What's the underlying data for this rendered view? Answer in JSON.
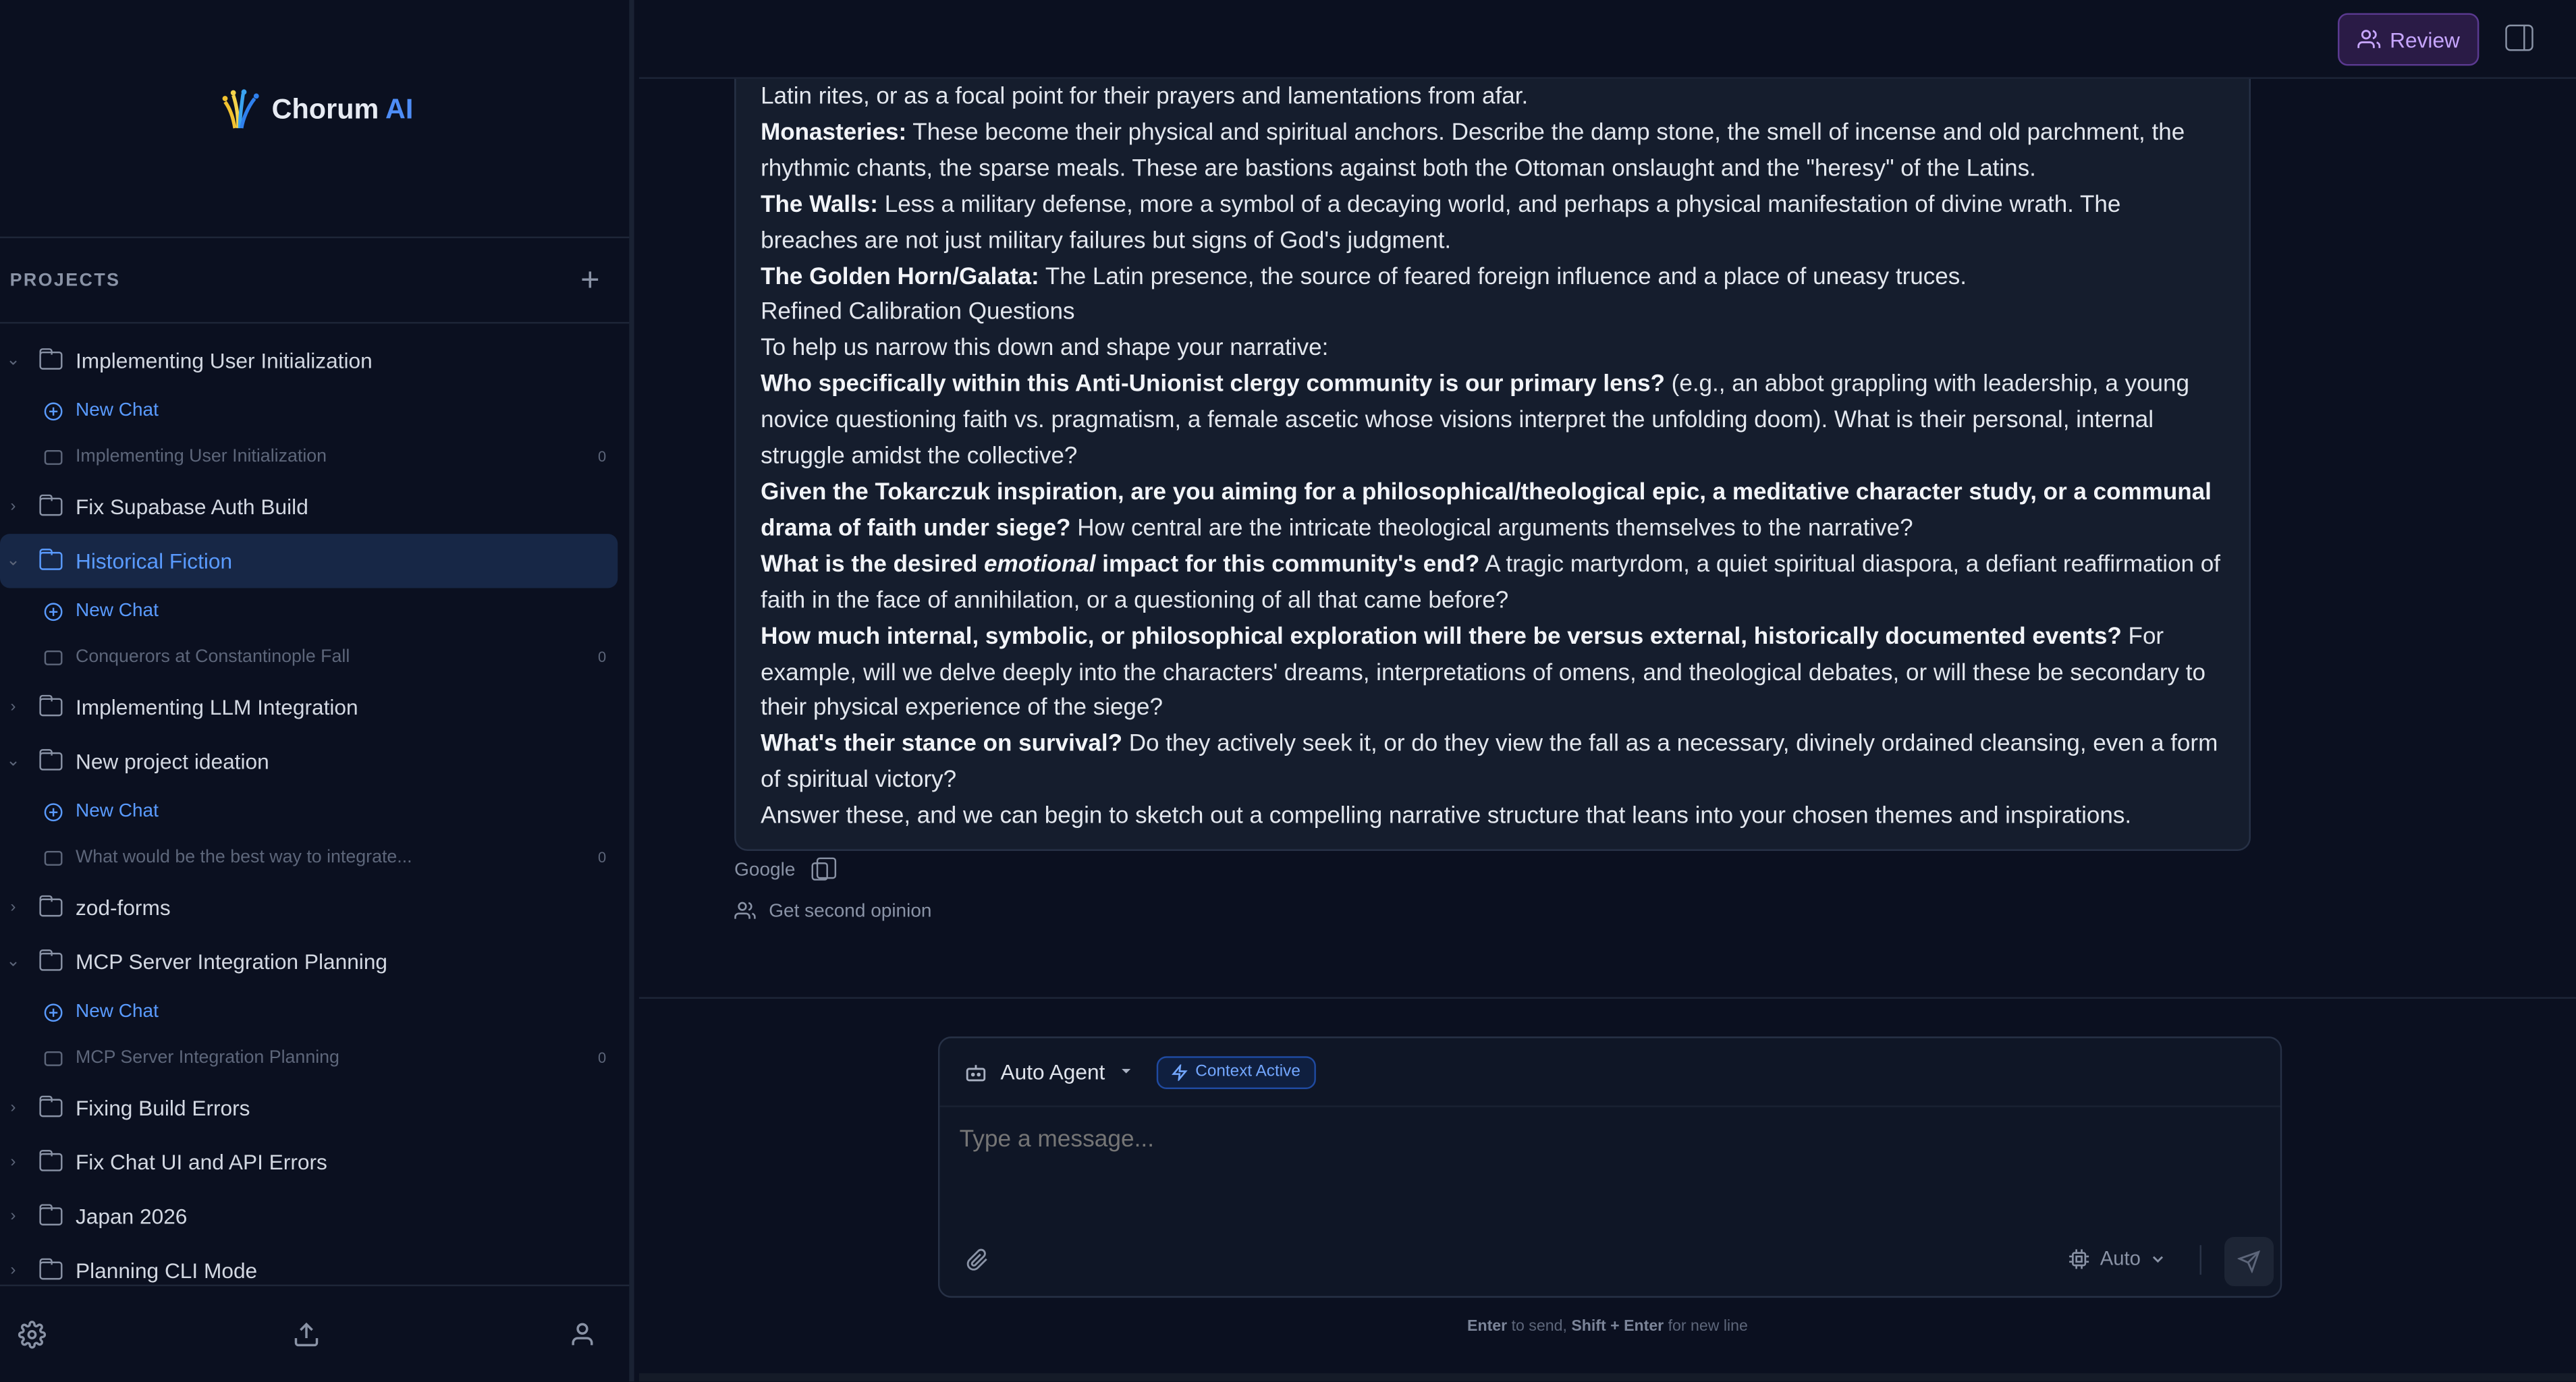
{
  "brand": {
    "name": "Chorum",
    "suffix": "AI"
  },
  "sidebar": {
    "section_label": "PROJECTS",
    "projects": [
      {
        "name": "Implementing User Initialization",
        "expanded": true,
        "new_chat": "New Chat",
        "chats": [
          {
            "title": "Implementing User Initialization",
            "count": "0"
          }
        ]
      },
      {
        "name": "Fix Supabase Auth Build",
        "expanded": false
      },
      {
        "name": "Historical Fiction",
        "expanded": true,
        "active": true,
        "new_chat": "New Chat",
        "chats": [
          {
            "title": "Conquerors at Constantinople Fall",
            "count": "0"
          }
        ]
      },
      {
        "name": "Implementing LLM Integration",
        "expanded": false
      },
      {
        "name": "New project ideation",
        "expanded": true,
        "new_chat": "New Chat",
        "chats": [
          {
            "title": "What would be the best way to integrate...",
            "count": "0"
          }
        ]
      },
      {
        "name": "zod-forms",
        "expanded": false
      },
      {
        "name": "MCP Server Integration Planning",
        "expanded": true,
        "new_chat": "New Chat",
        "chats": [
          {
            "title": "MCP Server Integration Planning",
            "count": "0"
          }
        ]
      },
      {
        "name": "Fixing Build Errors",
        "expanded": false
      },
      {
        "name": "Fix Chat UI and API Errors",
        "expanded": false
      },
      {
        "name": "Japan 2026",
        "expanded": false
      },
      {
        "name": "Planning CLI Mode",
        "expanded": false
      }
    ]
  },
  "topbar": {
    "review_label": "Review"
  },
  "message": {
    "line_0": "Latin rites, or as a focal point for their prayers and lamentations from afar.",
    "monasteries_b": "Monasteries:",
    "monasteries_t": " These become their physical and spiritual anchors. Describe the damp stone, the smell of incense and old parchment, the rhythmic chants, the sparse meals. These are bastions against both the Ottoman onslaught and the \"heresy\" of the Latins.",
    "walls_b": "The Walls:",
    "walls_t": " Less a military defense, more a symbol of a decaying world, and perhaps a physical manifestation of divine wrath. The breaches are not just military failures but signs of God's judgment.",
    "horn_b": "The Golden Horn/Galata:",
    "horn_t": " The Latin presence, the source of feared foreign influence and a place of uneasy truces.",
    "heading": "Refined Calibration Questions",
    "intro": "To help us narrow this down and shape your narrative:",
    "q1_b": "Who specifically within this Anti-Unionist clergy community is our primary lens?",
    "q1_t": " (e.g., an abbot grappling with leadership, a young novice questioning faith vs. pragmatism, a female ascetic whose visions interpret the unfolding doom). What is their personal, internal struggle amidst the collective?",
    "q2_b": "Given the Tokarczuk inspiration, are you aiming for a philosophical/theological epic, a meditative character study, or a communal drama of faith under siege?",
    "q2_t": " How central are the intricate theological arguments themselves to the narrative?",
    "q3_b1": "What is the desired ",
    "q3_i": "emotional",
    "q3_b2": " impact for this community's end?",
    "q3_t": " A tragic martyrdom, a quiet spiritual diaspora, a defiant reaffirmation of faith in the face of annihilation, or a questioning of all that came before?",
    "q4_b": "How much internal, symbolic, or philosophical exploration will there be versus external, historically documented events?",
    "q4_t": " For example, will we delve deeply into the characters' dreams, interpretations of omens, and theological debates, or will these be secondary to their physical experience of the siege?",
    "q5_b": "What's their stance on survival?",
    "q5_t": " Do they actively seek it, or do they view the fall as a necessary, divinely ordained cleansing, even a form of spiritual victory?",
    "closing": "Answer these, and we can begin to sketch out a compelling narrative structure that leans into your chosen themes and inspirations.",
    "provider": "Google",
    "second_opinion": "Get second opinion"
  },
  "composer": {
    "agent_label": "Auto Agent",
    "context_badge": "Context Active",
    "placeholder": "Type a message...",
    "mode_label": "Auto"
  },
  "hint": {
    "enter": "Enter",
    "to_send": " to send, ",
    "shift_enter": "Shift + Enter",
    "new_line": " for new line"
  }
}
